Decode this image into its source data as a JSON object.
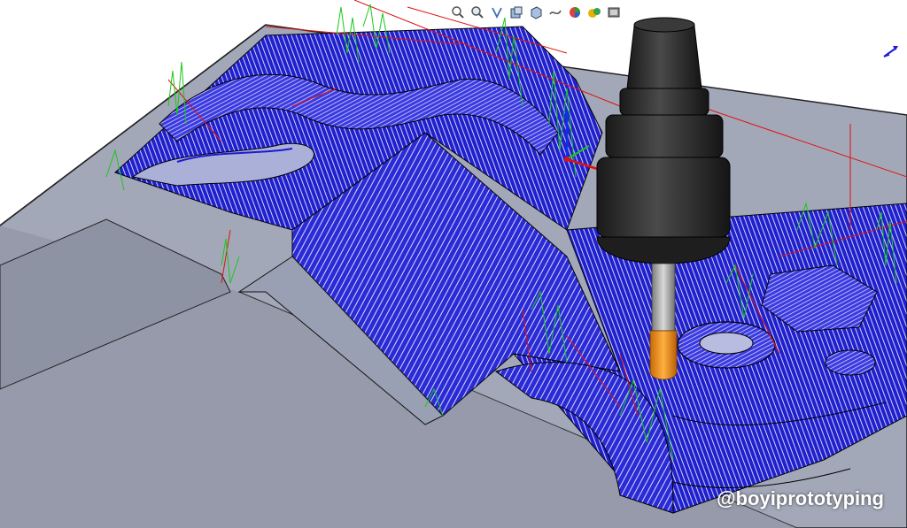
{
  "toolbar": {
    "icons": [
      "zoom-to-fit-icon",
      "zoom-area-icon",
      "previous-view-icon",
      "section-view-icon",
      "view-orientation-icon",
      "display-style-icon",
      "hide-show-icon",
      "edit-appearance-icon",
      "apply-scene-icon",
      "view-settings-icon"
    ]
  },
  "watermark": {
    "text": "@boyiprototyping"
  },
  "colors": {
    "part_gray": "#9ea3b3",
    "part_dark": "#7a7f8f",
    "toolpath_blue": "#1a1ad8",
    "toolpath_line": "#000033",
    "rapid_red": "#e01010",
    "link_green": "#19c819",
    "holder_black": "#2a2a2a",
    "tool_orange": "#f08a1c",
    "shank_gray": "#a8a8a8"
  }
}
